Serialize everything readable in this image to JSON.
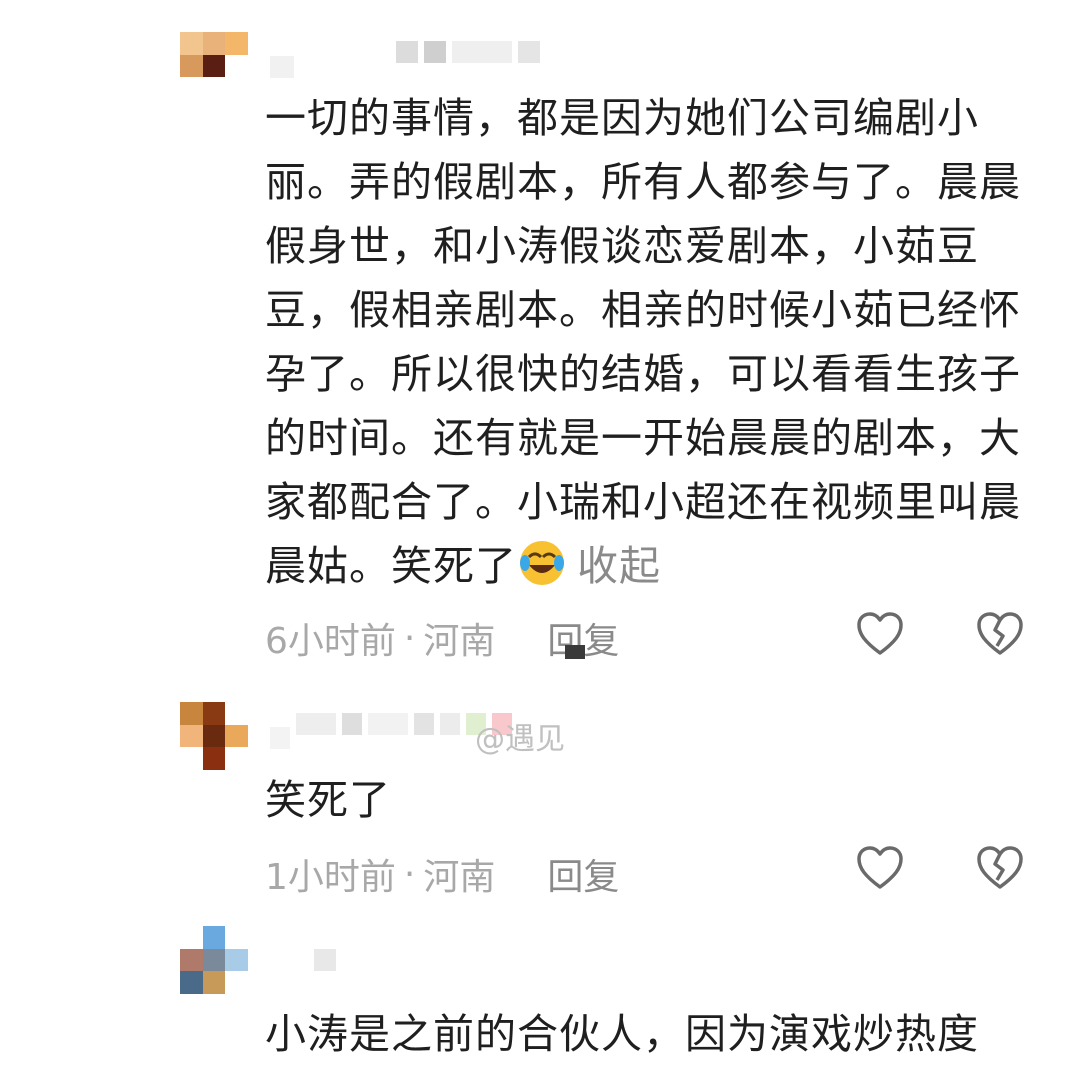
{
  "comments": [
    {
      "text": "一切的事情，都是因为她们公司编剧小丽。弄的假剧本，所有人都参与了。晨晨假身世，和小涛假谈恋爱剧本，小茹豆豆，假相亲剧本。相亲的时候小茹已经怀孕了。所以很快的结婚，可以看看生孩子的时间。还有就是一开始晨晨的剧本，大家都配合了。小瑞和小超还在视频里叫晨晨姑。笑死了",
      "emoji": "laughing-tears-emoji",
      "collapse_label": "收起",
      "time": "6小时前",
      "separator": "·",
      "location": "河南",
      "reply_label": "回复"
    },
    {
      "reply_to_partial": "@遇见",
      "text": "笑死了",
      "time": "1小时前",
      "separator": "·",
      "location": "河南",
      "reply_label": "回复"
    },
    {
      "text": "小涛是之前的合伙人，因为演戏炒热度"
    }
  ],
  "icons": {
    "like": "heart-outline-icon",
    "dislike": "broken-heart-icon"
  },
  "colors": {
    "text": "#1f1f1f",
    "meta": "#a8a8a8",
    "reply": "#8a8a8a"
  }
}
